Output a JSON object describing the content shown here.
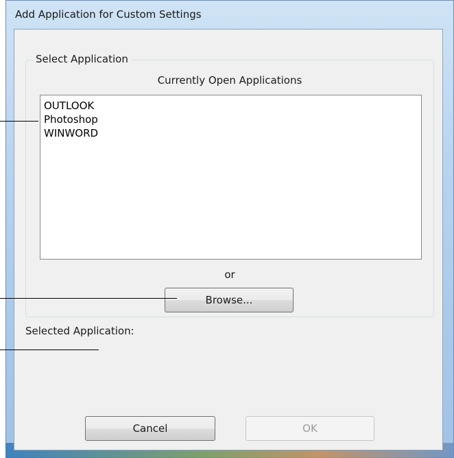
{
  "window": {
    "title": "Add Application for Custom Settings"
  },
  "select_group": {
    "legend": "Select Application",
    "list_caption": "Currently Open Applications",
    "applications": [
      "OUTLOOK",
      "Photoshop",
      "WINWORD"
    ],
    "or_text": "or",
    "browse_label": "Browse..."
  },
  "selected_application": {
    "label": "Selected Application:"
  },
  "footer": {
    "cancel_label": "Cancel",
    "ok_label": "OK"
  }
}
